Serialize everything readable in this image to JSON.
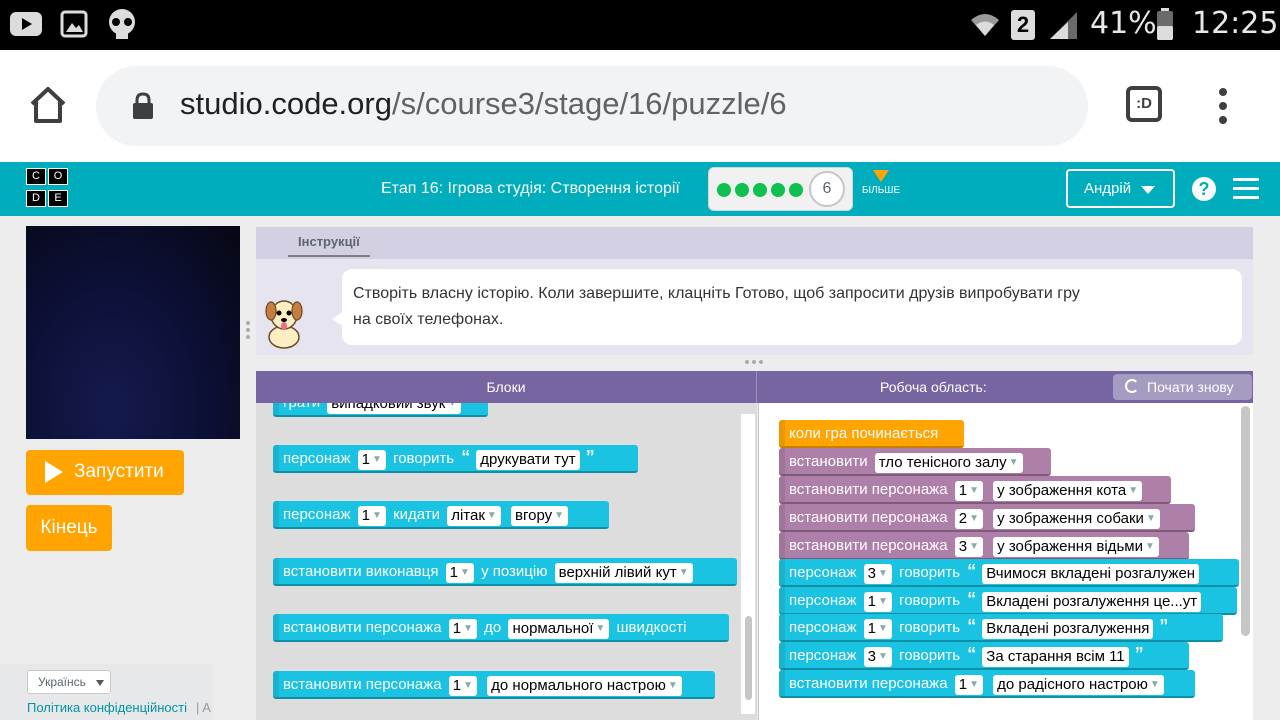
{
  "status_bar": {
    "battery_percent": "41%",
    "time": "12:25",
    "sim_number": "2"
  },
  "browser": {
    "url_host": "studio.code.org",
    "url_path": "/s/course3/stage/16/puzzle/6"
  },
  "header": {
    "logo_letters": [
      "C",
      "O",
      "D",
      "E"
    ],
    "stage_title": "Етап 16: Ігрова студія: Створення історії",
    "progress_dots": 5,
    "current_level": "6",
    "more_label": "БІЛЬШЕ",
    "user_name": "Андрій",
    "help_symbol": "?"
  },
  "left_panel": {
    "run_button": "Запустити",
    "finish_button": "Кінець",
    "language": "Українсь",
    "privacy_link": "Політика конфіденційності",
    "separator": "|  A"
  },
  "instructions": {
    "tab": "Інструкції",
    "text_line1": "Створіть власну історію. Коли завершите, клацніть Готово, щоб запросити друзів випробувати гру",
    "text_line2": "на своїх телефонах."
  },
  "workspace_header": {
    "blocks_label": "Блоки",
    "workspace_label": "Робоча область:",
    "restart_label": "Почати знову"
  },
  "toolbox_blocks": {
    "b0": {
      "text": "грати",
      "field": "випадковий звук"
    },
    "b1": {
      "prefix": "персонаж",
      "num": "1",
      "verb": "говорить",
      "field": "друкувати тут"
    },
    "b2": {
      "prefix": "персонаж",
      "num": "1",
      "verb": "кидати",
      "field1": "літак",
      "field2": "вгору"
    },
    "b3": {
      "prefix": "встановити виконавця",
      "num": "1",
      "verb": "у позицію",
      "field": "верхній лівий кут"
    },
    "b4": {
      "prefix": "встановити персонажа",
      "num": "1",
      "verb": "до",
      "field": "нормальної",
      "suffix": "швидкості"
    },
    "b5": {
      "prefix": "встановити персонажа",
      "num": "1",
      "field": "до нормального настрою"
    }
  },
  "workspace_blocks": {
    "w0": {
      "text": "коли гра починається"
    },
    "w1": {
      "prefix": "встановити",
      "field": "тло тенісного залу"
    },
    "w2": {
      "prefix": "встановити персонажа",
      "num": "1",
      "field": "у зображення кота"
    },
    "w3": {
      "prefix": "встановити персонажа",
      "num": "2",
      "field": "у зображення собаки"
    },
    "w4": {
      "prefix": "встановити персонажа",
      "num": "3",
      "field": "у зображення відьми"
    },
    "w5": {
      "prefix": "персонаж",
      "num": "3",
      "verb": "говорить",
      "field": "Вчимося вкладені розгалужен"
    },
    "w6": {
      "prefix": "персонаж",
      "num": "1",
      "verb": "говорить",
      "field": "Вкладені розгалуження це...ут"
    },
    "w7": {
      "prefix": "персонаж",
      "num": "1",
      "verb": "говорить",
      "field": "Вкладені розгалуження"
    },
    "w8": {
      "prefix": "персонаж",
      "num": "3",
      "verb": "говорить",
      "field": "За старання всім 11"
    },
    "w9": {
      "prefix": "встановити персонажа",
      "num": "1",
      "field": "до радісного настрою"
    }
  },
  "colors": {
    "header_teal": "#00adbc",
    "action_orange": "#ffa400",
    "block_teal": "#19c3e1",
    "block_purple": "#ae7fa8",
    "workspace_header": "#7665a0"
  }
}
